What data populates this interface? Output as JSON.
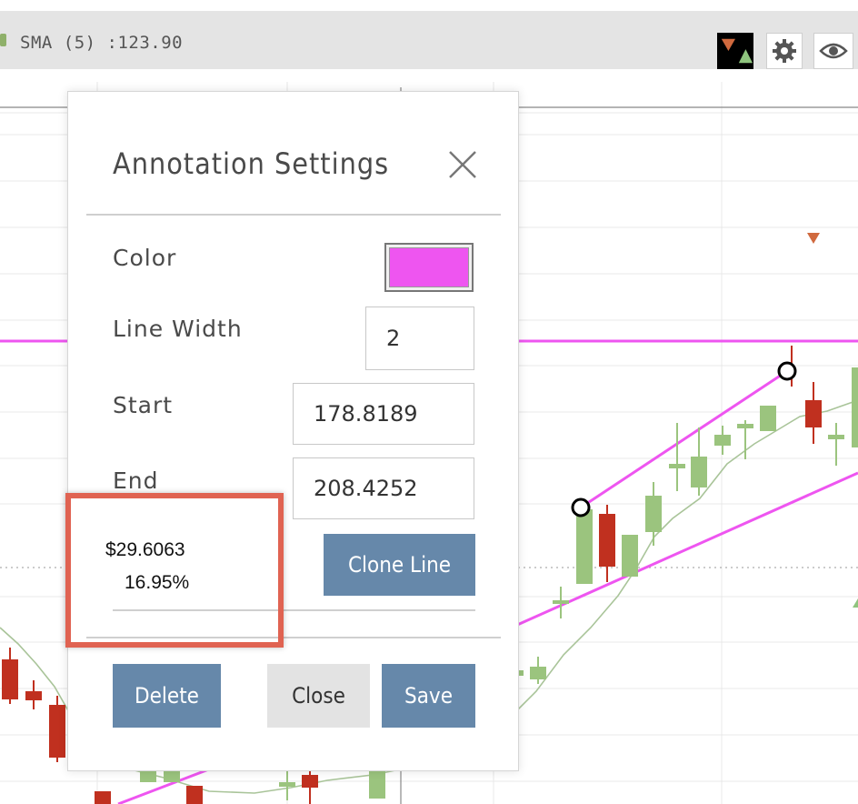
{
  "toolbar": {
    "legend_text": "SMA (5) :123.90",
    "legend_color": "#8fb06a",
    "icons": [
      "up-down-triangles-icon",
      "gear-icon",
      "eye-icon"
    ]
  },
  "chart": {
    "line_color": "#ee55f0",
    "up_color": "#9bc47e",
    "down_color": "#c0301f"
  },
  "dialog": {
    "title": "Annotation Settings",
    "close_icon": "close-icon",
    "color_label": "Color",
    "color_value": "#ee55f0",
    "line_width_label": "Line Width",
    "line_width_value": "2",
    "start_label": "Start",
    "start_value": "178.8189",
    "end_label": "End",
    "end_value": "208.4252",
    "price_change": "$29.6063",
    "percent_change": "16.95%",
    "clone_label": "Clone Line",
    "delete_label": "Delete",
    "close_label": "Close",
    "save_label": "Save"
  }
}
